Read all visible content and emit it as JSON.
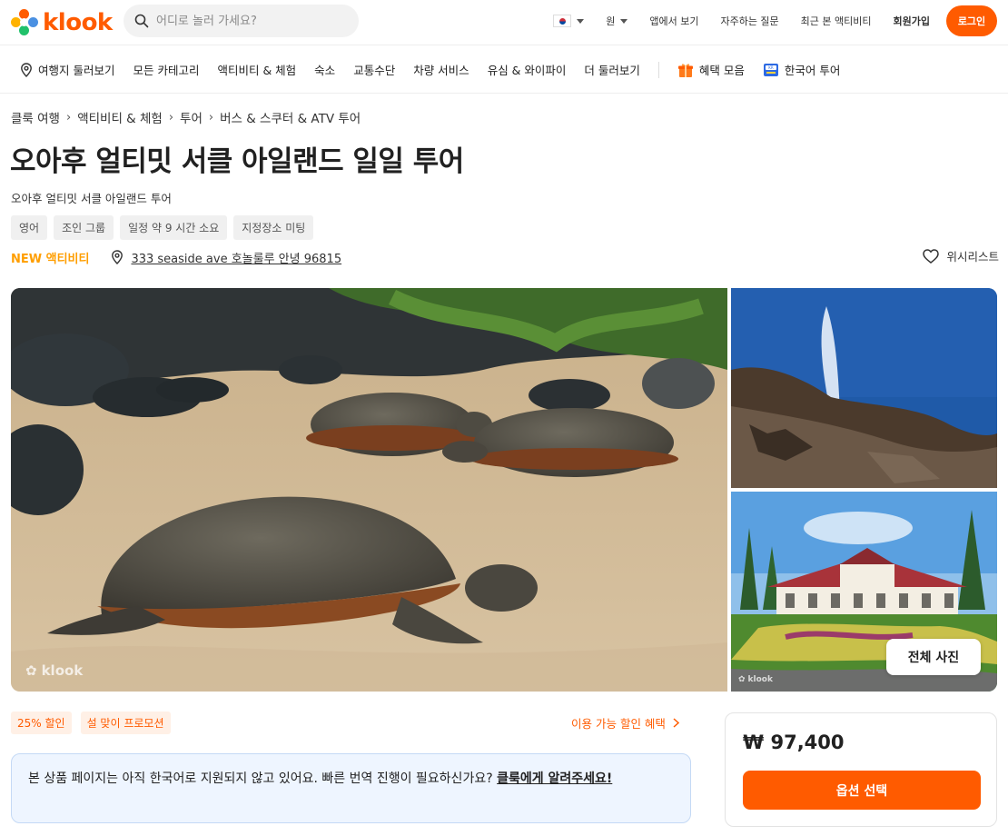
{
  "header": {
    "logo_text": "klook",
    "search_placeholder": "어디로 놀러 가세요?",
    "currency": "원",
    "links": [
      "앱에서 보기",
      "자주하는 질문",
      "최근 본 액티비티"
    ],
    "signup": "회원가입",
    "login": "로그인"
  },
  "nav": {
    "destinations": "여행지 둘러보기",
    "categories": [
      "모든 카테고리",
      "액티비티 & 체험",
      "숙소",
      "교통수단",
      "차량 서비스",
      "유심 & 와이파이",
      "더 둘러보기"
    ],
    "deals": "혜택 모음",
    "korean_tours": "한국어 투어"
  },
  "breadcrumb": [
    "클룩 여행",
    "액티비티 & 체험",
    "투어",
    "버스 & 스쿠터 & ATV 투어"
  ],
  "product": {
    "title": "오아후 얼티밋 서클 아일랜드 일일 투어",
    "subtitle": "오아후 얼티밋 서클 아일랜드 투어",
    "tags": [
      "영어",
      "조인 그룹",
      "일정 약 9 시간 소요",
      "지정장소 미팅"
    ],
    "new_label": "NEW 액티비티",
    "address": "333 seaside ave 호놀룰루 안녕 96815",
    "wishlist": "위시리스트"
  },
  "gallery": {
    "all_photos": "전체 사진",
    "watermark": "klook"
  },
  "promos": [
    "25% 할인",
    "설 맞이 프로모션"
  ],
  "discount_link": "이용 가능 할인 혜택",
  "notice": {
    "text": "본 상품 페이지는 아직 한국어로 지원되지 않고 있어요. 빠른 번역 진행이 필요하신가요? ",
    "link": "클룩에게 알려주세요!"
  },
  "booking": {
    "price": "₩ 97,400",
    "button": "옵션 선택"
  },
  "colors": {
    "brand": "#ff5b00",
    "new_label": "#ff9e00",
    "notice_bg": "#eef5ff"
  }
}
